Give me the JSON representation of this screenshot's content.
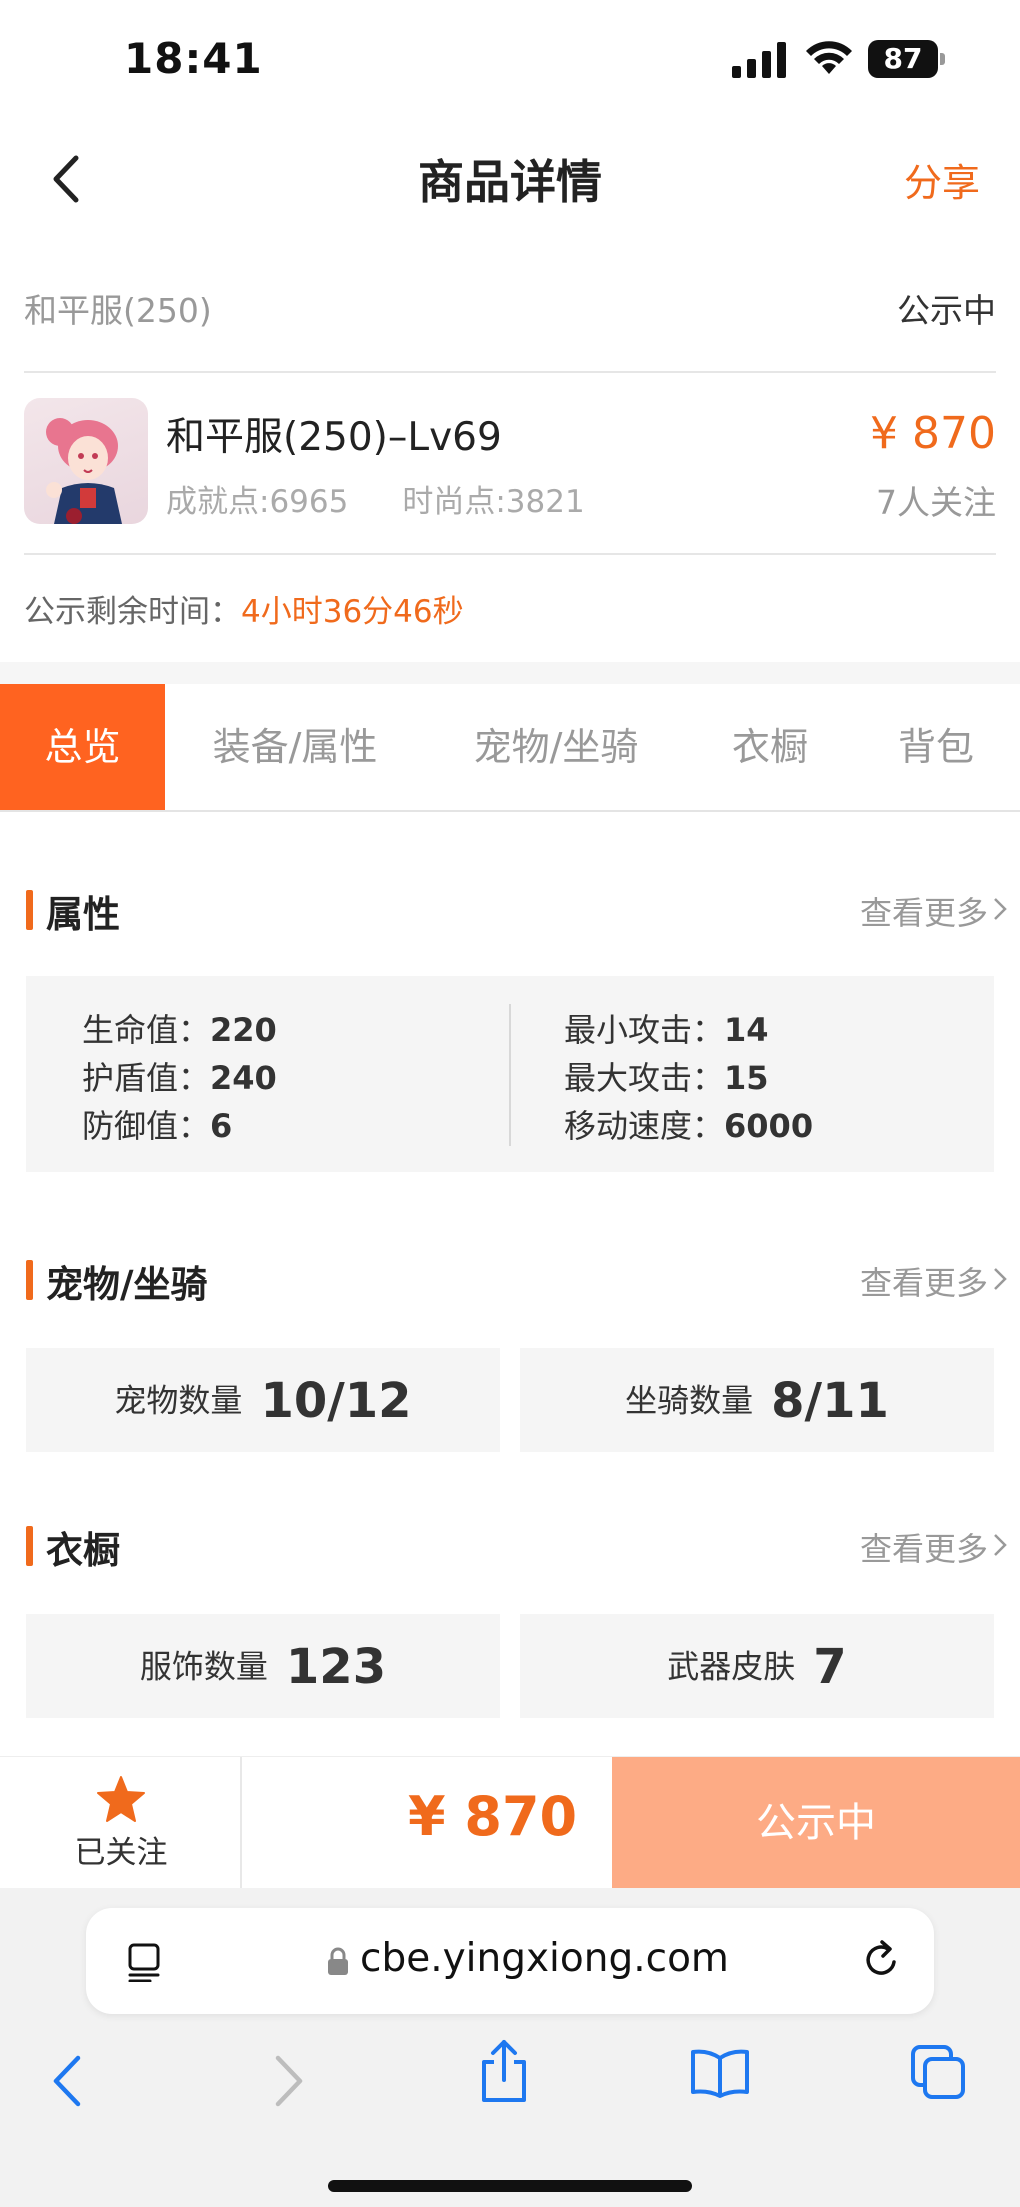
{
  "status_bar": {
    "time": "18:41",
    "battery": "87"
  },
  "nav": {
    "title": "商品详情",
    "share": "分享"
  },
  "server": {
    "name": "和平服(250)",
    "status": "公示中"
  },
  "product": {
    "title": "和平服(250)–Lv69",
    "achievement": "成就点:6965",
    "fashion": "时尚点:3821",
    "price": "¥ 870",
    "followers": "7人关注"
  },
  "countdown": {
    "label": "公示剩余时间：",
    "value": "4小时36分46秒"
  },
  "tabs": [
    {
      "label": "总览",
      "active": true
    },
    {
      "label": "装备/属性",
      "active": false
    },
    {
      "label": "宠物/坐骑",
      "active": false
    },
    {
      "label": "衣橱",
      "active": false
    },
    {
      "label": "背包",
      "active": false
    }
  ],
  "sections": {
    "attributes": {
      "title": "属性",
      "more": "查看更多",
      "left": [
        {
          "key": "生命值：",
          "value": "220"
        },
        {
          "key": "护盾值：",
          "value": "240"
        },
        {
          "key": "防御值：",
          "value": "6"
        }
      ],
      "right": [
        {
          "key": "最小攻击：",
          "value": "14"
        },
        {
          "key": "最大攻击：",
          "value": "15"
        },
        {
          "key": "移动速度：",
          "value": "6000"
        }
      ]
    },
    "pets": {
      "title": "宠物/坐骑",
      "more": "查看更多",
      "stats": [
        {
          "label": "宠物数量",
          "value": "10/12"
        },
        {
          "label": "坐骑数量",
          "value": "8/11"
        }
      ]
    },
    "wardrobe": {
      "title": "衣橱",
      "more": "查看更多",
      "stats": [
        {
          "label": "服饰数量",
          "value": "123"
        },
        {
          "label": "武器皮肤",
          "value": "7"
        }
      ]
    }
  },
  "action_bar": {
    "follow_label": "已关注",
    "price": "¥ 870",
    "status_button": "公示中"
  },
  "browser": {
    "url": "cbe.yingxiong.com"
  },
  "colors": {
    "accent": "#F06A1C",
    "tab_active": "#FF6320",
    "status_button": "#FDAB85"
  }
}
